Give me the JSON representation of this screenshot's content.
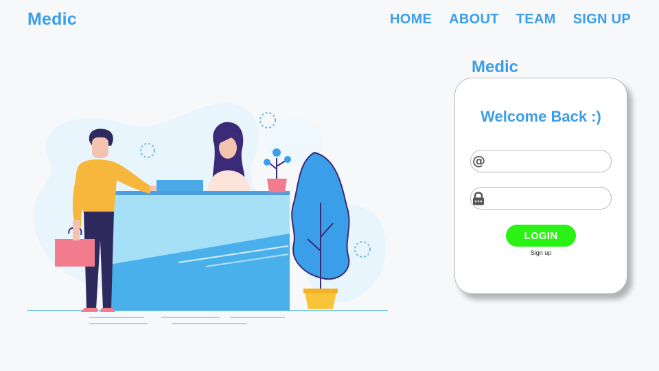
{
  "brand": "Medic",
  "nav": {
    "home": "HOME",
    "about": "ABOUT",
    "team": "TEAM",
    "signup": "SIGN UP"
  },
  "card": {
    "brand": "Medic",
    "welcome": "Welcome Back :)",
    "email_icon": "at-icon",
    "email_glyph": "@",
    "email_value": "",
    "password_icon": "lock-icon",
    "password_value": "",
    "login_label": "LOGIN",
    "signup_label": "Sign up"
  },
  "colors": {
    "accent": "#3b9ee8",
    "login_button": "#2af214",
    "background": "#f7f8fa"
  }
}
